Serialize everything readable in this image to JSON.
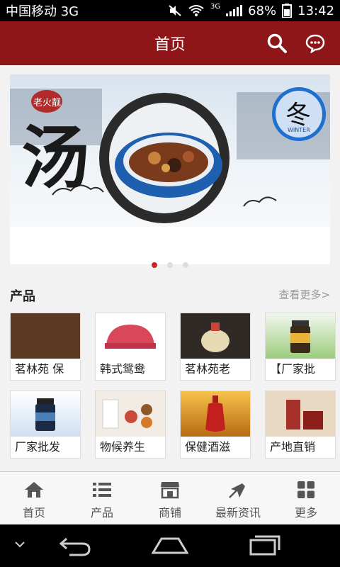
{
  "status": {
    "carrier": "中国移动 3G",
    "network": "3G",
    "battery": "68%",
    "time": "13:42"
  },
  "header": {
    "title": "首页"
  },
  "banner": {
    "chars": {
      "main": "汤",
      "small": "老火靓",
      "season": "冬",
      "winter": "WINTER"
    },
    "slide_count": 3,
    "active_slide": 1
  },
  "section": {
    "title": "产品",
    "more": "查看更多>"
  },
  "products": [
    {
      "name": "茗林苑 保",
      "thumb_color": "#5a3a22"
    },
    {
      "name": "韩式鸳鸯",
      "thumb_color": "#d9475a"
    },
    {
      "name": "茗林苑老",
      "thumb_color": "#2f2a26"
    },
    {
      "name": "【厂家批",
      "thumb_color": "#6da255"
    },
    {
      "name": "厂家批发",
      "thumb_color": "#4a7fb8"
    },
    {
      "name": "物候养生",
      "thumb_color": "#c94a3a"
    },
    {
      "name": "保健酒滋",
      "thumb_color": "#d6922a"
    },
    {
      "name": "产地直销",
      "thumb_color": "#a8302a"
    }
  ],
  "tabs": [
    {
      "label": "首页",
      "icon": "home-icon"
    },
    {
      "label": "产品",
      "icon": "list-icon"
    },
    {
      "label": "商铺",
      "icon": "shop-icon"
    },
    {
      "label": "最新资讯",
      "icon": "news-icon"
    },
    {
      "label": "更多",
      "icon": "grid-icon"
    }
  ],
  "colors": {
    "brand": "#8e1618",
    "active_dot": "#c7262b"
  }
}
